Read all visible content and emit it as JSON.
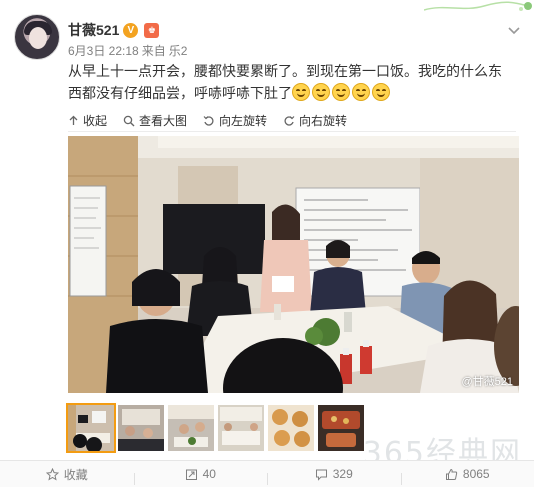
{
  "user": {
    "name": "甘薇521",
    "verify_badge": "V",
    "level_badge": "♚"
  },
  "post": {
    "date": "6月3日 22:18",
    "source_prefix": "来自",
    "source": "乐2",
    "text": "从早上十一点开会，腰都快要累断了。到现在第一口饭。我吃的什么东西都没有仔细品尝，呼哧呼哧下肚了",
    "emoji_count": 5
  },
  "toolbar": {
    "collapse": "收起",
    "view_large": "查看大图",
    "rotate_left": "向左旋转",
    "rotate_right": "向右旋转"
  },
  "photo": {
    "watermark": "@甘薇521"
  },
  "site_watermark": "365经典网",
  "actions": {
    "favorite": "收藏",
    "repost_count": "40",
    "comment_count": "329",
    "like_count": "8065"
  },
  "colors": {
    "accent_orange": "#f39c12",
    "text_gray": "#808080",
    "verify_gold": "#f3a321"
  }
}
